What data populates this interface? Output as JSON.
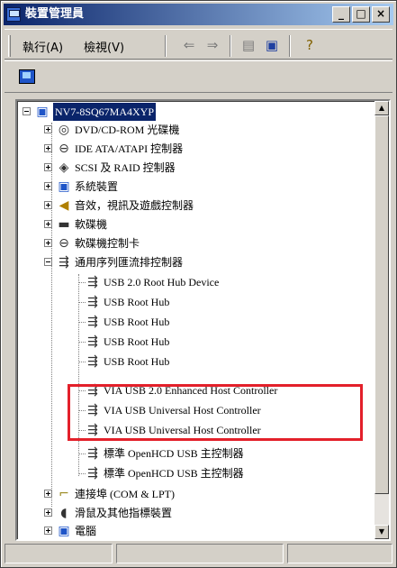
{
  "window": {
    "title": "裝置管理員",
    "buttons": [
      "_",
      "□",
      "×"
    ]
  },
  "menu": {
    "items": [
      "執行(A)",
      "檢視(V)"
    ]
  },
  "toolbar": {
    "icons": [
      "back-arrow-icon",
      "forward-arrow-icon",
      "properties-icon",
      "console-tree-icon",
      "help-icon"
    ]
  },
  "tree": {
    "root": "NV7-8SQ67MA4XYP",
    "items": [
      {
        "label": "DVD/CD-ROM 光碟機",
        "icon": "dvd-icon"
      },
      {
        "label": "IDE ATA/ATAPI 控制器",
        "icon": "ide-icon"
      },
      {
        "label": "SCSI 及 RAID 控制器",
        "icon": "scsi-icon"
      },
      {
        "label": "系統裝置",
        "icon": "system-icon"
      },
      {
        "label": "音效，視訊及遊戲控制器",
        "icon": "sound-icon"
      },
      {
        "label": "軟碟機",
        "icon": "floppy-icon"
      },
      {
        "label": "軟碟機控制卡",
        "icon": "floppy-controller-icon"
      },
      {
        "label": "通用序列匯流排控制器",
        "icon": "usb-icon",
        "expanded": true,
        "children": [
          "USB 2.0 Root Hub Device",
          "USB Root Hub",
          "USB Root Hub",
          "USB Root Hub",
          "USB Root Hub",
          "VIA USB 2.0 Enhanced Host Controller",
          "VIA USB Universal Host Controller",
          "VIA USB Universal Host Controller",
          "標準 OpenHCD USB 主控制器",
          "標準 OpenHCD USB 主控制器"
        ]
      },
      {
        "label": "連接埠 (COM & LPT)",
        "icon": "port-icon"
      },
      {
        "label": "滑鼠及其他指標裝置",
        "icon": "mouse-icon"
      },
      {
        "label": "電腦",
        "icon": "computer-icon"
      }
    ]
  },
  "highlight_color": "#e3202a"
}
